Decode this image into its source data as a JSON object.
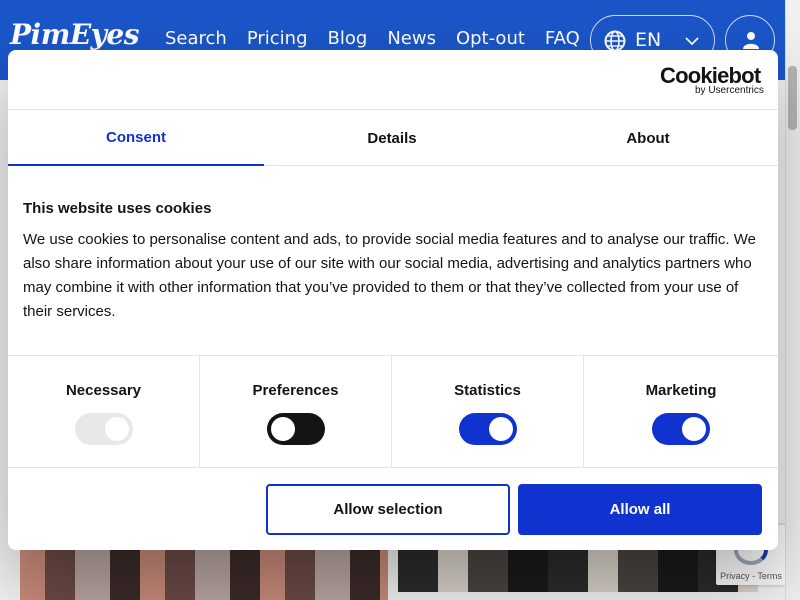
{
  "header": {
    "logo": "PimEyes",
    "nav": [
      "Search",
      "Pricing",
      "Blog",
      "News",
      "Opt-out",
      "FAQ"
    ],
    "language": "EN",
    "brand_color": "#1b56c9"
  },
  "recaptcha": {
    "text": "Privacy - Terms"
  },
  "cookie_dialog": {
    "brand": {
      "name": "Cookiebot",
      "byline": "by Usercentrics"
    },
    "tabs": [
      {
        "label": "Consent",
        "active": true
      },
      {
        "label": "Details",
        "active": false
      },
      {
        "label": "About",
        "active": false
      }
    ],
    "title": "This website uses cookies",
    "body": "We use cookies to personalise content and ads, to provide social media features and to analyse our traffic. We also share information about your use of our site with our social media, advertising and analytics partners who may combine it with other information that you’ve provided to them or that they’ve collected from your use of their services.",
    "toggles": [
      {
        "label": "Necessary",
        "state": "on-disabled"
      },
      {
        "label": "Preferences",
        "state": "off"
      },
      {
        "label": "Statistics",
        "state": "on"
      },
      {
        "label": "Marketing",
        "state": "on"
      }
    ],
    "buttons": {
      "allow_selection": "Allow selection",
      "allow_all": "Allow all"
    },
    "accent_color": "#1032cf"
  }
}
